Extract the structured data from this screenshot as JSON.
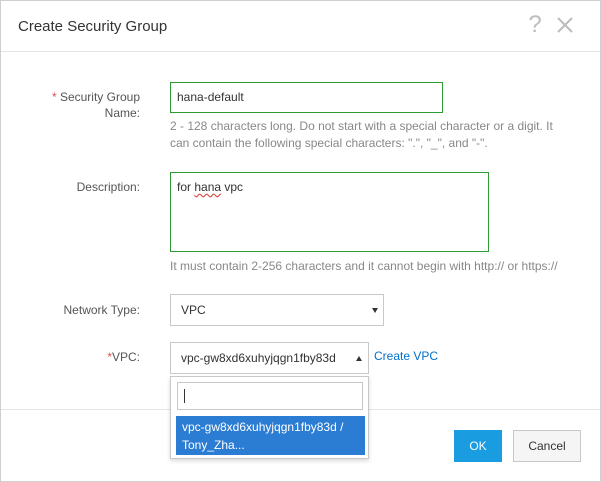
{
  "dialog": {
    "title": "Create Security Group",
    "help_icon": "question-mark-icon",
    "close_icon": "close-x-icon"
  },
  "form": {
    "name": {
      "required_mark": "*",
      "label_line1": "Security Group",
      "label_line2": "Name:",
      "value": "hana-default",
      "hint_line1": "2 - 128 characters long. Do not start with a special character or a digit. It",
      "hint_line2": "can contain the following special characters: \".\", \"_\", and \"-\"."
    },
    "description": {
      "label": "Description:",
      "value_prefix": "for ",
      "value_misspelled": "hana",
      "value_suffix": " vpc",
      "hint": "It must contain 2-256 characters and it cannot begin with http:// or https://"
    },
    "network_type": {
      "label": "Network Type:",
      "value": "VPC"
    },
    "vpc": {
      "required_mark": "*",
      "label": "VPC:",
      "value": "vpc-gw8xd6xuhyjqgn1fby83d",
      "create_link": "Create VPC",
      "dropdown": {
        "search_value": "",
        "options": [
          {
            "line1": "vpc-gw8xd6xuhyjqgn1fby83d /",
            "line2": "Tony_Zha..."
          }
        ]
      }
    }
  },
  "footer": {
    "ok_label": "OK",
    "cancel_label": "Cancel"
  },
  "colors": {
    "primary_button": "#1a9ce0",
    "valid_border": "#2e9a33",
    "link": "#0070cc",
    "selected_option": "#2b7cd3",
    "required": "#d9534f"
  }
}
